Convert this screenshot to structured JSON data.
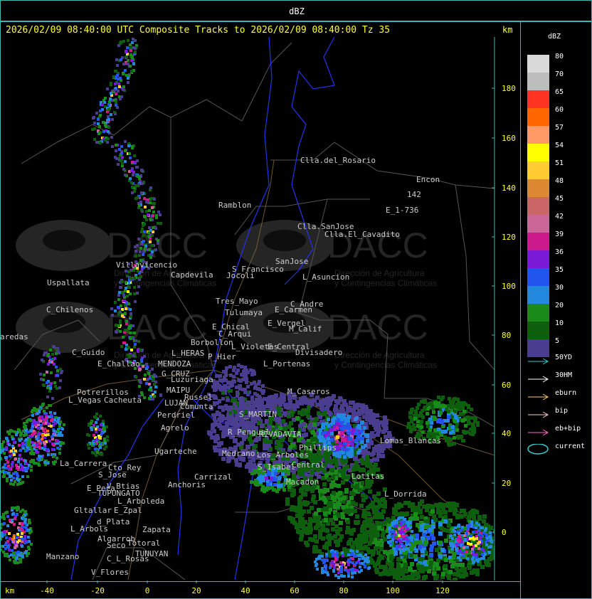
{
  "window_title": "dBZ",
  "header": {
    "text": "2026/02/09 08:40:00 UTC Composite Tracks to 2026/02/09 08:40:00 Tz 35",
    "km_label": "km"
  },
  "bottom_km_label": "km",
  "axes": {
    "x_ticks": [
      "-40",
      "-20",
      "0",
      "20",
      "40",
      "60",
      "80",
      "100",
      "120"
    ],
    "y_ticks": [
      "180",
      "160",
      "140",
      "120",
      "100",
      "80",
      "60",
      "40",
      "20",
      "0"
    ]
  },
  "legend": {
    "title": "dBZ",
    "items": [
      {
        "value": "80",
        "color": "#d9d9d9"
      },
      {
        "value": "70",
        "color": "#bdbdbd"
      },
      {
        "value": "65",
        "color": "#ff3322"
      },
      {
        "value": "60",
        "color": "#ff6600"
      },
      {
        "value": "57",
        "color": "#ff9966"
      },
      {
        "value": "54",
        "color": "#ffff00"
      },
      {
        "value": "51",
        "color": "#ffcc33"
      },
      {
        "value": "48",
        "color": "#dd8833"
      },
      {
        "value": "45",
        "color": "#cc6666"
      },
      {
        "value": "42",
        "color": "#cc6699"
      },
      {
        "value": "39",
        "color": "#cc1a8c"
      },
      {
        "value": "36",
        "color": "#7a1ad6"
      },
      {
        "value": "35",
        "color": "#2255ee"
      },
      {
        "value": "30",
        "color": "#2288dd"
      },
      {
        "value": "20",
        "color": "#1a8a1a"
      },
      {
        "value": "10",
        "color": "#0d5e0d"
      },
      {
        "value": "5",
        "color": "#4a3d8f"
      }
    ]
  },
  "tracks": [
    {
      "label": "50YD",
      "color": "#33cccc"
    },
    {
      "label": "30HM",
      "color": "#ffffff"
    },
    {
      "label": "eburn",
      "color": "#ffcc66"
    },
    {
      "label": "bip",
      "color": "#ffcccc"
    },
    {
      "label": "eb+bip",
      "color": "#ff66cc"
    },
    {
      "label": "current",
      "color": "#33cccc"
    }
  ],
  "watermark": {
    "brand": "DACC",
    "line1": "Dirección de Agricultura",
    "line2": "y Contingencias Climáticas"
  },
  "places": [
    {
      "name": "Clla.del_Rosario",
      "color": "#cccccc"
    },
    {
      "name": "Encon",
      "color": "#cccccc"
    },
    {
      "name": "142",
      "color": "#cccccc"
    },
    {
      "name": "E_1-736",
      "color": "#cccccc"
    },
    {
      "name": "Ramblon",
      "color": "#cccccc"
    },
    {
      "name": "Clla.SanJose",
      "color": "#cccccc"
    },
    {
      "name": "Clla.El_Cavadito",
      "color": "#cccccc"
    },
    {
      "name": "Villavicencio",
      "color": "#cccccc"
    },
    {
      "name": "Uspallata",
      "color": "#cccccc"
    },
    {
      "name": "Capdevila",
      "color": "#cccccc"
    },
    {
      "name": "S_Francisco",
      "color": "#cccccc"
    },
    {
      "name": "SanJose",
      "color": "#cccccc"
    },
    {
      "name": "Jocoli",
      "color": "#cccccc"
    },
    {
      "name": "L_Asuncion",
      "color": "#cccccc"
    },
    {
      "name": "C_Chilenos",
      "color": "#cccccc"
    },
    {
      "name": "Tres_Mayo",
      "color": "#cccccc"
    },
    {
      "name": "C_Andre",
      "color": "#cccccc"
    },
    {
      "name": "Tulumaya",
      "color": "#cccccc"
    },
    {
      "name": "E_Carmen",
      "color": "#cccccc"
    },
    {
      "name": "aredas",
      "color": "#cccccc"
    },
    {
      "name": "E_Chical",
      "color": "#cccccc"
    },
    {
      "name": "C_Arqui",
      "color": "#cccccc"
    },
    {
      "name": "E_Vergel",
      "color": "#cccccc"
    },
    {
      "name": "M_Calif",
      "color": "#cccccc"
    },
    {
      "name": "Borbollon",
      "color": "#cccccc"
    },
    {
      "name": "L_Violetas",
      "color": "#cccccc"
    },
    {
      "name": "E_Central",
      "color": "#cccccc"
    },
    {
      "name": "C_Guido",
      "color": "#cccccc"
    },
    {
      "name": "L_HERAS",
      "color": "#cccccc"
    },
    {
      "name": "P_Hier",
      "color": "#cccccc"
    },
    {
      "name": "Divisadero",
      "color": "#cccccc"
    },
    {
      "name": "E_Challao",
      "color": "#cccccc"
    },
    {
      "name": "MENDOZA",
      "color": "#cccccc"
    },
    {
      "name": "L_Portenas",
      "color": "#cccccc"
    },
    {
      "name": "G_CRUZ",
      "color": "#cccccc"
    },
    {
      "name": "Luzuriaga",
      "color": "#cccccc"
    },
    {
      "name": "MAIPU",
      "color": "#cccccc"
    },
    {
      "name": "Russel",
      "color": "#cccccc"
    },
    {
      "name": "Potrerillos",
      "color": "#cccccc"
    },
    {
      "name": "L_Vegas",
      "color": "#cccccc"
    },
    {
      "name": "Cacheuta",
      "color": "#cccccc"
    },
    {
      "name": "LUJAN",
      "color": "#cccccc"
    },
    {
      "name": "Cumunta",
      "color": "#cccccc"
    },
    {
      "name": "M_Caseros",
      "color": "#cccccc"
    },
    {
      "name": "S_MARTIN",
      "color": "#cccccc"
    },
    {
      "name": "Perdriel",
      "color": "#cccccc"
    },
    {
      "name": "Agrelo",
      "color": "#cccccc"
    },
    {
      "name": "R_Pengual",
      "color": "#cccccc"
    },
    {
      "name": "RIVADAVIA",
      "color": "#cccccc"
    },
    {
      "name": "Phillips",
      "color": "#cccccc"
    },
    {
      "name": "Lomas_Blancas",
      "color": "#cccccc"
    },
    {
      "name": "Ugarteche",
      "color": "#cccccc"
    },
    {
      "name": "Medrano",
      "color": "#cccccc"
    },
    {
      "name": "Los_Arboles",
      "color": "#cccccc"
    },
    {
      "name": "S_Isabel",
      "color": "#cccccc"
    },
    {
      "name": "Central",
      "color": "#cccccc"
    },
    {
      "name": "La_Carrera",
      "color": "#cccccc"
    },
    {
      "name": "Cto_Rey",
      "color": "#cccccc"
    },
    {
      "name": "S_Jose",
      "color": "#cccccc"
    },
    {
      "name": "Carrizal",
      "color": "#cccccc"
    },
    {
      "name": "Lotitas",
      "color": "#cccccc"
    },
    {
      "name": "Anchoris",
      "color": "#cccccc"
    },
    {
      "name": "Macadon",
      "color": "#cccccc"
    },
    {
      "name": "E_Pera",
      "color": "#cccccc"
    },
    {
      "name": "V_Btias",
      "color": "#cccccc"
    },
    {
      "name": "TUPUNGATO",
      "color": "#cccccc"
    },
    {
      "name": "L_Dorrida",
      "color": "#cccccc"
    },
    {
      "name": "L_Arboleda",
      "color": "#cccccc"
    },
    {
      "name": "Gltallar",
      "color": "#cccccc"
    },
    {
      "name": "E_Zpal",
      "color": "#cccccc"
    },
    {
      "name": "d_Plata",
      "color": "#cccccc"
    },
    {
      "name": "L_Arbols",
      "color": "#cccccc"
    },
    {
      "name": "Zapata",
      "color": "#cccccc"
    },
    {
      "name": "Algarrob",
      "color": "#cccccc"
    },
    {
      "name": "Seco",
      "color": "#cccccc"
    },
    {
      "name": "Totoral",
      "color": "#cccccc"
    },
    {
      "name": "TUNUYAN",
      "color": "#cccccc"
    },
    {
      "name": "Manzano",
      "color": "#cccccc"
    },
    {
      "name": "C_L_Rosas",
      "color": "#cccccc"
    },
    {
      "name": "V_Flores",
      "color": "#cccccc"
    }
  ]
}
